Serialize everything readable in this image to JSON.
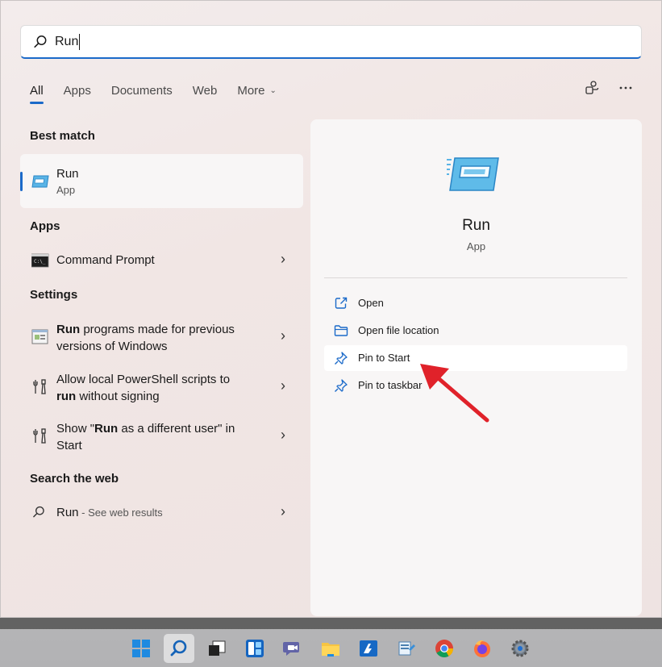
{
  "search": {
    "value": "Run"
  },
  "tabs": [
    {
      "label": "All"
    },
    {
      "label": "Apps"
    },
    {
      "label": "Documents"
    },
    {
      "label": "Web"
    },
    {
      "label": "More"
    }
  ],
  "sections": {
    "best_match": "Best match",
    "apps": "Apps",
    "settings": "Settings",
    "search_web": "Search the web"
  },
  "best_match": {
    "title": "Run",
    "subtitle": "App"
  },
  "apps": [
    {
      "label": "Command Prompt"
    }
  ],
  "settings": [
    {
      "bold": "Run",
      "rest": " programs made for previous",
      "line2": "versions of Windows"
    },
    {
      "line1": "Allow local PowerShell scripts to",
      "bold": "run",
      "rest": " without signing"
    },
    {
      "pre": "Show \"",
      "bold": "Run",
      "post": " as a different user\" in",
      "line2": "Start"
    }
  ],
  "web": {
    "label": "Run",
    "sub": " - See web results"
  },
  "preview": {
    "name": "Run",
    "kind": "App",
    "actions": [
      {
        "label": "Open",
        "icon": "open-external-icon"
      },
      {
        "label": "Open file location",
        "icon": "folder-icon"
      },
      {
        "label": "Pin to Start",
        "icon": "pin-icon"
      },
      {
        "label": "Pin to taskbar",
        "icon": "pin-icon"
      }
    ]
  },
  "taskbar": {
    "items": [
      "start-icon",
      "search-icon",
      "task-view-icon",
      "widgets-icon",
      "teams-chat-icon",
      "file-explorer-icon",
      "remote-desktop-icon",
      "tools-icon",
      "chrome-icon",
      "firefox-icon",
      "settings-icon"
    ]
  },
  "colors": {
    "accent": "#1b6ac9",
    "annotation_arrow": "#e0222a"
  }
}
